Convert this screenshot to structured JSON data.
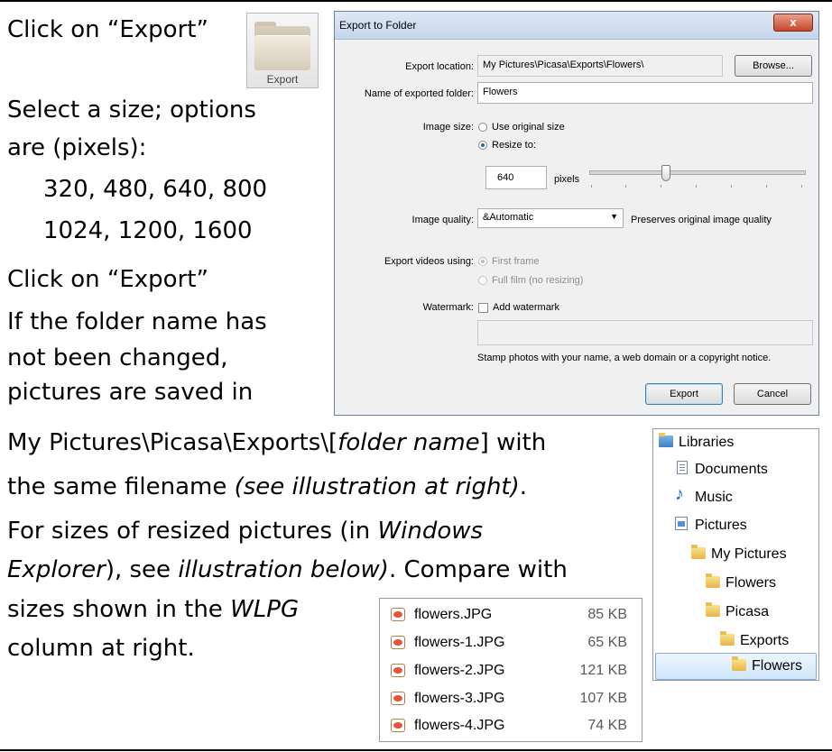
{
  "instructions": {
    "step1": "Click on “Export”",
    "step2_line1": "Select a size; options",
    "step2_line2": "are (pixels):",
    "sizes_line1": "320, 480, 640, 800",
    "sizes_line2": "1024, 1200, 1600",
    "step3": "Click on “Export”",
    "note_line1": "If the folder name has",
    "note_line2": "not been changed,",
    "note_line3": "pictures are saved in",
    "path_plain": "My Pictures\\Picasa\\Exports\\[",
    "path_italic": "folder name",
    "path_end": "] with",
    "same_plain": "the same filename ",
    "same_italic": "(see illustration at right)",
    "same_end": ".",
    "sizes_a": "For sizes of resized pictures (in ",
    "sizes_a_italic": "Windows",
    "sizes_b_italic": "Explorer",
    "sizes_b_plain": "), see ",
    "sizes_b_italic2": "illustration below)",
    "sizes_b_end": ". Compare with",
    "sizes_c": "sizes shown in the ",
    "sizes_c_italic": "WLPG",
    "sizes_d": "column at right."
  },
  "export_icon": {
    "label": "Export"
  },
  "dialog": {
    "title": "Export to Folder",
    "close": "x",
    "export_location_label": "Export location:",
    "export_location_value": "My Pictures\\Picasa\\Exports\\Flowers\\",
    "browse_label": "Browse...",
    "folder_name_label": "Name of exported folder:",
    "folder_name_value": "Flowers",
    "image_size_label": "Image size:",
    "use_original": "Use original size",
    "resize_to": "Resize to:",
    "resize_value": "640",
    "pixels_label": "pixels",
    "slider_level": 0.35,
    "image_quality_label": "Image quality:",
    "image_quality_value": "&Automatic",
    "quality_note": "Preserves original image quality",
    "export_videos_label": "Export videos using:",
    "first_frame": "First frame",
    "full_film": "Full film (no resizing)",
    "watermark_label": "Watermark:",
    "add_watermark": "Add watermark",
    "watermark_value": "",
    "stamp_note": "Stamp photos with your name, a web domain or a copyright notice.",
    "export_button": "Export",
    "cancel_button": "Cancel"
  },
  "tree": {
    "items": [
      {
        "label": "Libraries",
        "icon": "library-icon"
      },
      {
        "label": "Documents",
        "icon": "document-icon"
      },
      {
        "label": "Music",
        "icon": "music-icon"
      },
      {
        "label": "Pictures",
        "icon": "pictures-icon"
      },
      {
        "label": "My Pictures",
        "icon": "folder-icon"
      },
      {
        "label": "Flowers",
        "icon": "folder-icon"
      },
      {
        "label": "Picasa",
        "icon": "folder-icon"
      },
      {
        "label": "Exports",
        "icon": "folder-icon"
      },
      {
        "label": "Flowers",
        "icon": "folder-icon"
      }
    ]
  },
  "files": [
    {
      "name": "flowers.JPG",
      "size": "85 KB"
    },
    {
      "name": "flowers-1.JPG",
      "size": "65 KB"
    },
    {
      "name": "flowers-2.JPG",
      "size": "121 KB"
    },
    {
      "name": "flowers-3.JPG",
      "size": "107 KB"
    },
    {
      "name": "flowers-4.JPG",
      "size": "74 KB"
    }
  ],
  "colors": {
    "selection": "#cfe6fb",
    "close_button": "#c7462a",
    "title_bar": "#c4d5ea"
  }
}
